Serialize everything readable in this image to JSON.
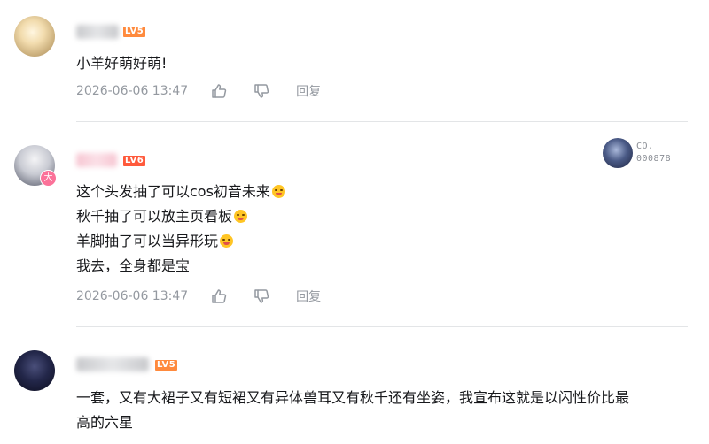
{
  "comments": [
    {
      "level": "LV5",
      "lines": [
        "小羊好萌好萌!"
      ],
      "time": "2026-06-06 13:47",
      "reply": "回复"
    },
    {
      "level": "LV6",
      "vbadge": "大",
      "lines": [
        "这个头发抽了可以cos初音未来",
        "秋千抽了可以放主页看板",
        "羊脚抽了可以当异形玩",
        "我去，全身都是宝"
      ],
      "time": "2026-06-06 13:47",
      "reply": "回复",
      "card": {
        "line1": "CO.",
        "line2": "000878"
      }
    },
    {
      "level": "LV5",
      "lines": [
        "一套，又有大裙子又有短裙又有异体兽耳又有秋千还有坐姿，我宣布这就是以闪性价比最",
        "高的六星"
      ]
    }
  ],
  "icons": {
    "like": "thumb-up-icon",
    "dislike": "thumb-down-icon",
    "emoji": "smile-emoji-icon"
  },
  "colors": {
    "accent": "#fb7299",
    "lv5": "#ff8a3d",
    "lv6": "#ff5a3c",
    "meta": "#9499a0"
  }
}
